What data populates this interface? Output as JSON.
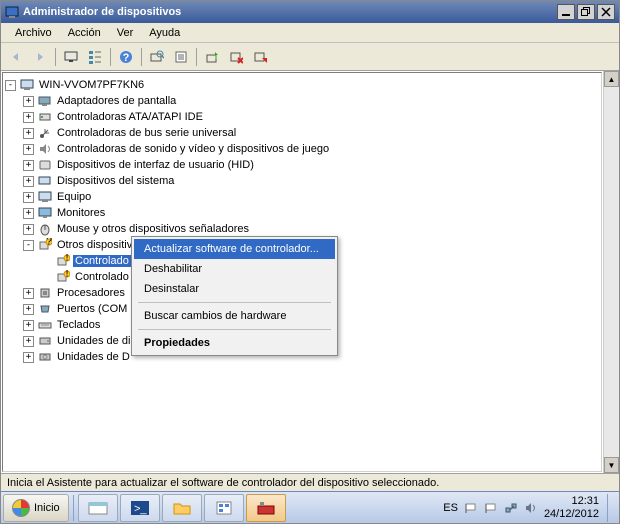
{
  "window": {
    "title": "Administrador de dispositivos"
  },
  "menu": {
    "file": "Archivo",
    "action": "Acción",
    "view": "Ver",
    "help": "Ayuda"
  },
  "tree": {
    "root": "WIN-VVOM7PF7KN6",
    "items": [
      {
        "label": "Adaptadores de pantalla",
        "exp": "+"
      },
      {
        "label": "Controladoras ATA/ATAPI IDE",
        "exp": "+"
      },
      {
        "label": "Controladoras de bus serie universal",
        "exp": "+"
      },
      {
        "label": "Controladoras de sonido y vídeo y dispositivos de juego",
        "exp": "+"
      },
      {
        "label": "Dispositivos de interfaz de usuario (HID)",
        "exp": "+"
      },
      {
        "label": "Dispositivos del sistema",
        "exp": "+"
      },
      {
        "label": "Equipo",
        "exp": "+"
      },
      {
        "label": "Monitores",
        "exp": "+"
      },
      {
        "label": "Mouse y otros dispositivos señaladores",
        "exp": "+"
      },
      {
        "label": "Otros dispositivos",
        "exp": "-"
      },
      {
        "label": "Procesadores",
        "exp": "+"
      },
      {
        "label": "Puertos (COM",
        "exp": "+"
      },
      {
        "label": "Teclados",
        "exp": "+"
      },
      {
        "label": "Unidades de di",
        "exp": "+"
      },
      {
        "label": "Unidades de D",
        "exp": "+"
      }
    ],
    "other_children": [
      {
        "label": "Controlado"
      },
      {
        "label": "Controlado"
      }
    ]
  },
  "context_menu": {
    "update": "Actualizar software de controlador...",
    "disable": "Deshabilitar",
    "uninstall": "Desinstalar",
    "scan": "Buscar cambios de hardware",
    "properties": "Propiedades"
  },
  "statusbar": {
    "text": "Inicia el Asistente para actualizar el software de controlador del dispositivo seleccionado."
  },
  "taskbar": {
    "start": "Inicio",
    "lang": "ES",
    "time": "12:31",
    "date": "24/12/2012"
  }
}
